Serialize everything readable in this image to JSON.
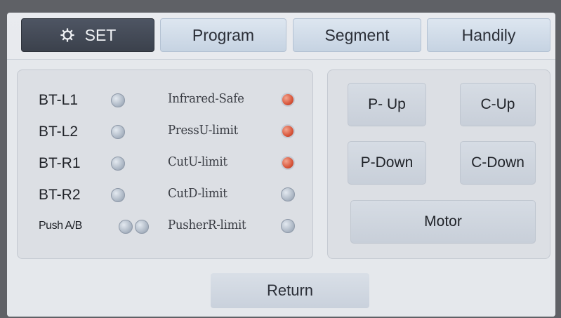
{
  "tabs": [
    {
      "label": "SET",
      "icon": "gear-icon",
      "active": true
    },
    {
      "label": "Program",
      "active": false
    },
    {
      "label": "Segment",
      "active": false
    },
    {
      "label": "Handily",
      "active": false
    }
  ],
  "left_inputs": [
    {
      "label": "BT-L1",
      "state": "off"
    },
    {
      "label": "BT-L2",
      "state": "off"
    },
    {
      "label": "BT-R1",
      "state": "off"
    },
    {
      "label": "BT-R2",
      "state": "off"
    },
    {
      "label": "Push A/B",
      "state": "off"
    }
  ],
  "limit_inputs": [
    {
      "label": "Infrared-Safe",
      "state": "on"
    },
    {
      "label": "PressU-limit",
      "state": "on"
    },
    {
      "label": "CutU-limit",
      "state": "on"
    },
    {
      "label": "CutD-limit",
      "state": "off"
    },
    {
      "label": "PusherR-limit",
      "state": "off"
    }
  ],
  "controls": {
    "p_up": "P- Up",
    "c_up": "C-Up",
    "p_down": "P-Down",
    "c_down": "C-Down",
    "motor": "Motor"
  },
  "footer": {
    "return_label": "Return"
  },
  "colors": {
    "led_on": "#d8553a",
    "led_off": "#a7b2c0",
    "active_tab": "#3b414c"
  }
}
